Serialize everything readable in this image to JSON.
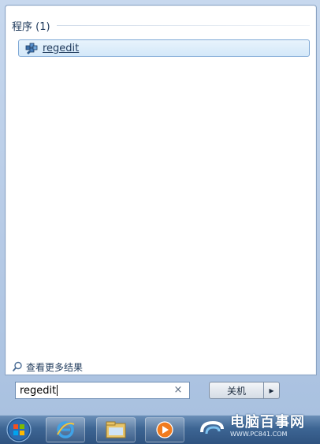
{
  "results": {
    "group_title": "程序 (1)",
    "items": [
      {
        "label": "regedit",
        "icon": "regedit-icon"
      }
    ]
  },
  "more_results": {
    "label": "查看更多结果",
    "icon": "search-icon"
  },
  "search": {
    "value": "regedit",
    "clear_icon": "clear-icon",
    "clear_glyph": "×"
  },
  "shutdown": {
    "label": "关机",
    "arrow_icon": "arrow-right-icon",
    "arrow_glyph": "▸"
  },
  "taskbar": {
    "start_icon": "windows-start-orb-icon",
    "pinned": [
      "internet-explorer-icon",
      "windows-explorer-icon",
      "media-player-icon"
    ]
  },
  "watermark": {
    "text": "电脑百事网",
    "url": "WWW.PC841.COM"
  },
  "colors": {
    "accent": "#1e395b",
    "selection": "#d4e8f9",
    "taskbar": "#3d6593"
  }
}
